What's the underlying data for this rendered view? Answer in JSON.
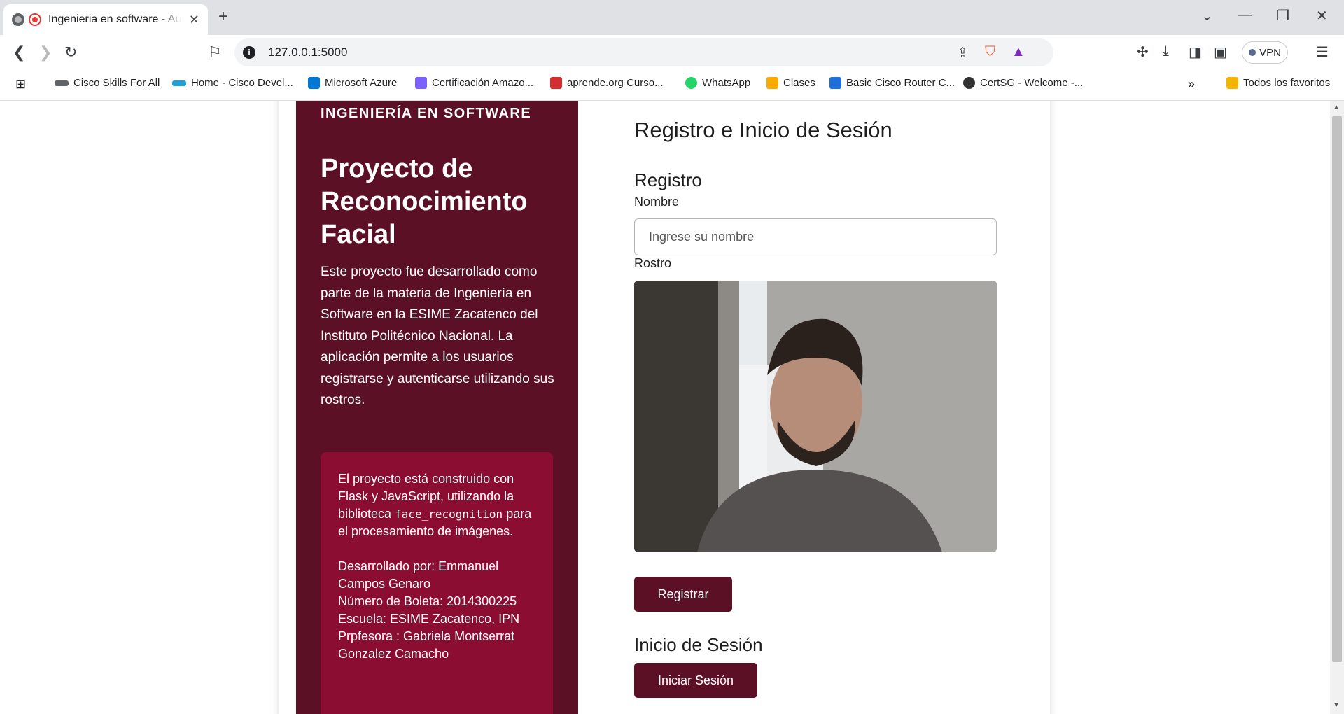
{
  "browser": {
    "tab_title": "Ingenieria en software - Autenticación",
    "new_tab": "+",
    "url": "127.0.0.1:5000",
    "vpn_label": "VPN",
    "bookmarks": [
      {
        "label": "Cisco Skills For All",
        "color": "#5f6368"
      },
      {
        "label": "Home - Cisco Devel...",
        "color": "#1ba0d7"
      },
      {
        "label": "Microsoft Azure",
        "color": "#0078d4"
      },
      {
        "label": "Certificación Amazo...",
        "color": "#7b61ff"
      },
      {
        "label": "aprende.org Curso...",
        "color": "#d32f2f"
      },
      {
        "label": "WhatsApp",
        "color": "#25d366"
      },
      {
        "label": "Clases",
        "color": "#f9ab00"
      },
      {
        "label": "Basic Cisco Router C...",
        "color": "#1e6fd9"
      },
      {
        "label": "CertSG - Welcome -...",
        "color": "#333333"
      }
    ],
    "all_bookmarks": "Todos los favoritos"
  },
  "sidebar": {
    "brand": "INGENIERÍA EN SOFTWARE",
    "title": "Proyecto de Reconocimiento Facial",
    "description": "Este proyecto fue desarrollado como parte de la materia de Ingeniería en Software en la ESIME Zacatenco del Instituto Politécnico Nacional. La aplicación permite a los usuarios registrarse y autenticarse utilizando sus rostros.",
    "info_pre": "El proyecto está construido con Flask y JavaScript, utilizando la biblioteca ",
    "info_code": "face_recognition",
    "info_post": " para el procesamiento de imágenes.",
    "developer": "Desarrollado por: Emmanuel Campos Genaro",
    "boleta": "Número de Boleta: 2014300225",
    "school": "Escuela: ESIME Zacatenco, IPN",
    "teacher": "Prpfesora : Gabriela Montserrat Gonzalez Camacho"
  },
  "main": {
    "page_title": "Registro e Inicio de Sesión",
    "register_heading": "Registro",
    "name_label": "Nombre",
    "name_placeholder": "Ingrese su nombre",
    "face_label": "Rostro",
    "register_button": "Registrar",
    "login_heading": "Inicio de Sesión",
    "login_button": "Iniciar Sesión"
  },
  "colors": {
    "sidebar_bg": "#5c1026",
    "info_box_bg": "#8b0d32",
    "button_bg": "#5c1026"
  }
}
